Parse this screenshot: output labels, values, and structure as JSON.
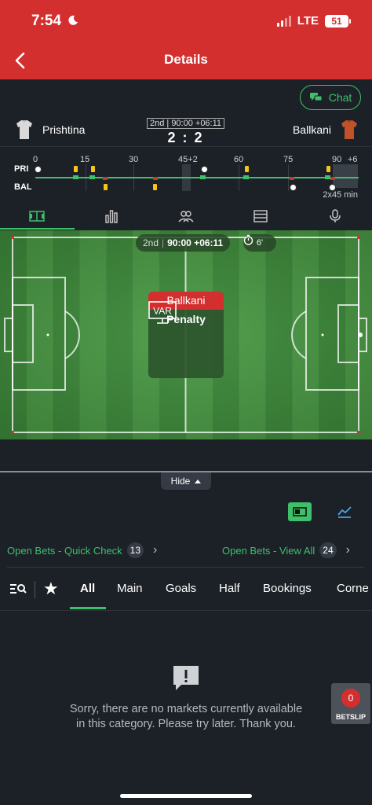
{
  "status_bar": {
    "time": "7:54",
    "network": "LTE",
    "battery": "51"
  },
  "header": {
    "title": "Details"
  },
  "chat": {
    "label": "Chat"
  },
  "match": {
    "home_team": "Prishtina",
    "away_team": "Ballkani",
    "period": "2nd",
    "clock": "90:00 +06:11",
    "score": "2 : 2"
  },
  "timeline": {
    "ticks": [
      "0",
      "15",
      "30",
      "45+2",
      "60",
      "75",
      "90",
      "+6"
    ],
    "home_abbr": "PRI",
    "away_abbr": "BAL",
    "duration": "2x45 min"
  },
  "view_tabs": [
    "pitch-icon",
    "stats-icon",
    "lineups-icon",
    "table-icon",
    "commentary-icon"
  ],
  "pitch": {
    "period": "2nd",
    "clock": "90:00 +06:11",
    "stopwatch": "6'",
    "event_team": "Ballkani",
    "event_icon_text": "VAR",
    "event_label": "Penalty"
  },
  "hide": {
    "label": "Hide"
  },
  "open_bets": {
    "quick_check_label": "Open Bets - Quick Check",
    "quick_check_count": "13",
    "view_all_label": "Open Bets - View All",
    "view_all_count": "24"
  },
  "market_tabs": {
    "active": "All",
    "items": [
      "All",
      "Main",
      "Goals",
      "Half",
      "Bookings",
      "Corne"
    ]
  },
  "empty_state": {
    "message": "Sorry, there are no markets currently available in this category. Please try later. Thank you."
  },
  "betslip": {
    "count": "0",
    "label": "BETSLIP"
  },
  "colors": {
    "brand_red": "#d32f2f",
    "accent_green": "#3ec06b",
    "background": "#1c2128",
    "card_yellow": "#f5c518"
  }
}
